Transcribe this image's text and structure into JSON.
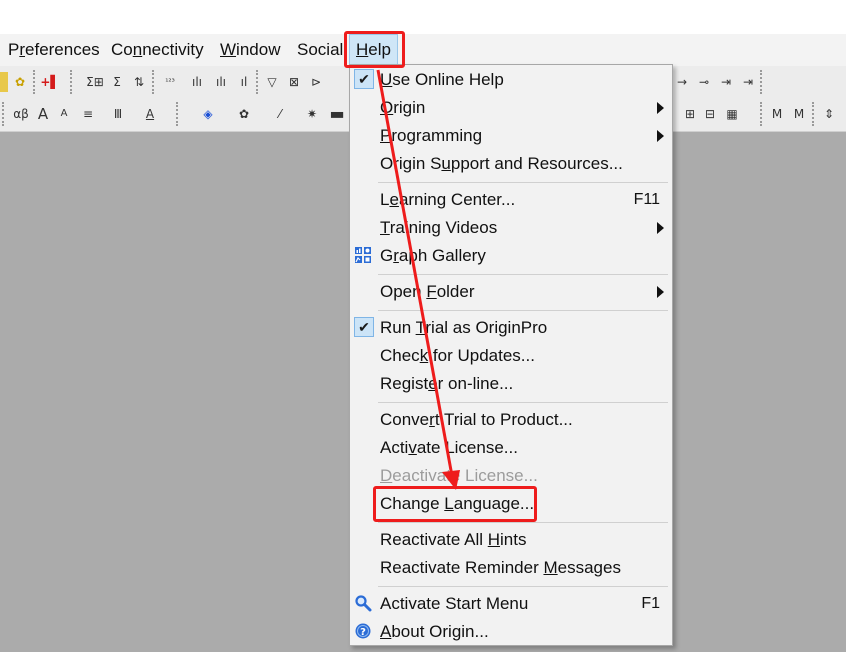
{
  "menubar": {
    "items": [
      {
        "pre": "P",
        "mn": "r",
        "post": "eferences"
      },
      {
        "pre": "Co",
        "mn": "n",
        "post": "nectivity"
      },
      {
        "pre": "",
        "mn": "W",
        "post": "indow"
      },
      {
        "pre": "Social",
        "mn": "",
        "post": ""
      },
      {
        "pre": "",
        "mn": "H",
        "post": "elp"
      }
    ]
  },
  "toolbar": {
    "row1": [
      "Σ⊞",
      "Σ",
      "⇅",
      "¹²³",
      "ılı",
      "ılı",
      "ıl",
      "▽",
      "⊠",
      "⊳"
    ],
    "row2": [
      "αβ",
      "A",
      "A",
      "≡",
      "Ⅲ",
      "A",
      "◈",
      "✿",
      "⁄",
      "✷",
      "▬"
    ],
    "right1": [
      "→",
      "⊸",
      "⇥"
    ],
    "right2": [
      "⊞",
      "⊟",
      "M",
      "M",
      "⇕",
      "▦"
    ]
  },
  "help_menu": {
    "items": [
      {
        "pre": "",
        "mn": "U",
        "post": "se Online Help",
        "checked": true
      },
      {
        "pre": "",
        "mn": "O",
        "post": "rigin",
        "submenu": true
      },
      {
        "pre": "",
        "mn": "P",
        "post": "rogramming",
        "submenu": true
      },
      {
        "pre": "Origin S",
        "mn": "u",
        "post": "pport and Resources..."
      },
      {
        "pre": "L",
        "mn": "e",
        "post": "arning Center...",
        "shortcut": "F11"
      },
      {
        "pre": "",
        "mn": "T",
        "post": "raining Videos",
        "submenu": true
      },
      {
        "pre": "G",
        "mn": "r",
        "post": "aph Gallery",
        "icon": "graph-gallery-icon"
      },
      {
        "pre": "Open ",
        "mn": "F",
        "post": "older",
        "submenu": true
      },
      {
        "pre": "Run ",
        "mn": "T",
        "post": "rial as OriginPro",
        "checked": true
      },
      {
        "pre": "Chec",
        "mn": "k",
        "post": " for Updates..."
      },
      {
        "pre": "Regist",
        "mn": "e",
        "post": "r on-line..."
      },
      {
        "pre": "Conve",
        "mn": "r",
        "post": "t Trial to Product..."
      },
      {
        "pre": "Acti",
        "mn": "v",
        "post": "ate License..."
      },
      {
        "pre": "",
        "mn": "D",
        "post": "eactivate License...",
        "disabled": true
      },
      {
        "pre": "Change ",
        "mn": "L",
        "post": "anguage..."
      },
      {
        "pre": "Reactivate All ",
        "mn": "H",
        "post": "ints"
      },
      {
        "pre": "Reactivate Reminder ",
        "mn": "M",
        "post": "essages"
      },
      {
        "pre": "Activate Start Menu",
        "mn": "",
        "post": "",
        "shortcut": "F1",
        "icon": "magnifier-icon"
      },
      {
        "pre": "",
        "mn": "A",
        "post": "bout Origin...",
        "icon": "info-icon"
      }
    ]
  },
  "colors": {
    "highlight": "#ee1c1c",
    "menu_bg": "#f2f2f2",
    "workspace_bg": "#ababab"
  }
}
